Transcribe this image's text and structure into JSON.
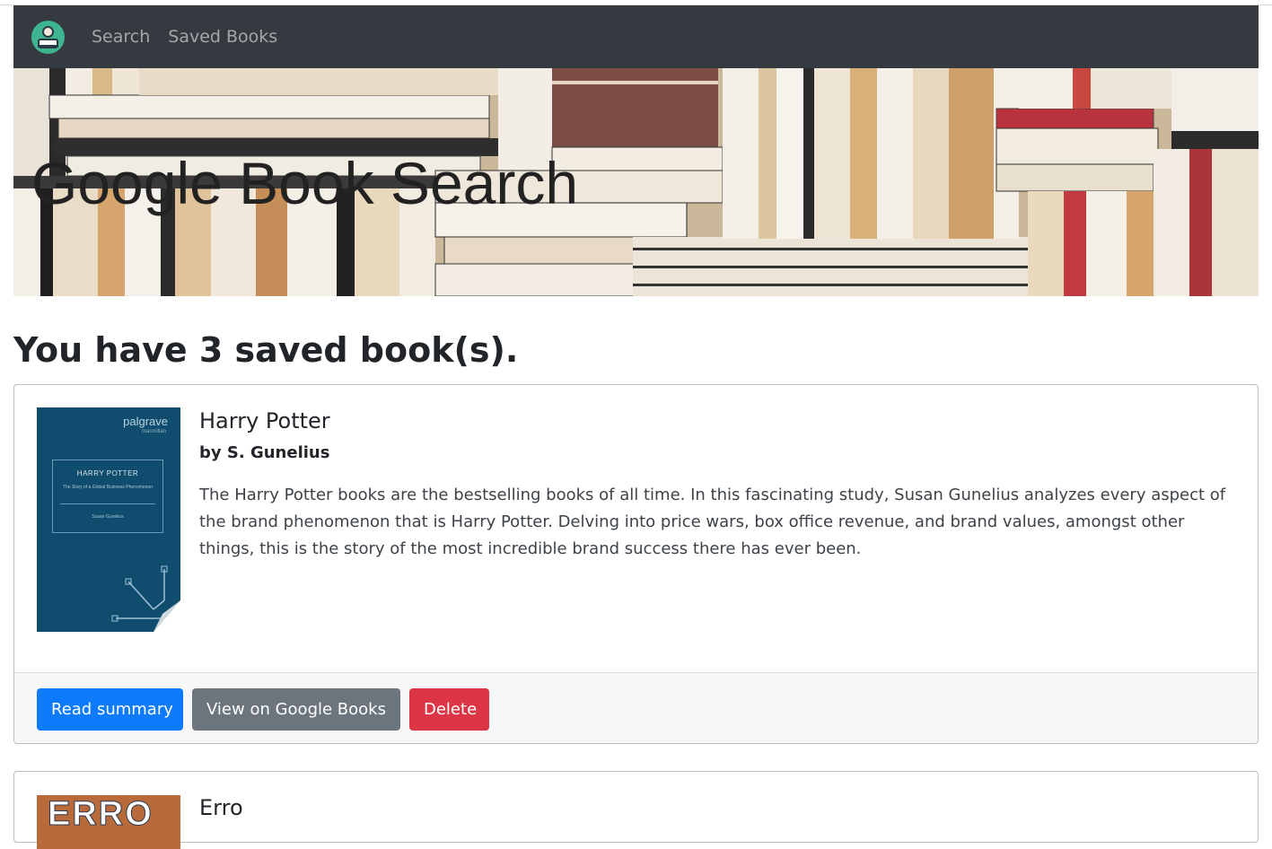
{
  "nav": {
    "logo_icon": "user-book-avatar-icon",
    "links": [
      "Search",
      "Saved Books"
    ]
  },
  "jumbotron": {
    "title": "Google Book Search",
    "background": "bookshelf-photo"
  },
  "saved_heading": "You have 3 saved book(s).",
  "books": [
    {
      "title": "Harry Potter",
      "author": "by S. Gunelius",
      "description": "The Harry Potter books are the bestselling books of all time. In this fascinating study, Susan Gunelius analyzes every aspect of the brand phenomenon that is Harry Potter. Delving into price wars, box office revenue, and brand values, amongst other things, this is the story of the most incredible brand success there has ever been.",
      "cover": {
        "publisher": "palgrave",
        "publisher_sub": "macmillan",
        "cover_title": "HARRY POTTER",
        "cover_subtitle": "The Story of a Global Business Phenomenon",
        "cover_author": "Susan Gunelius"
      },
      "buttons": {
        "read_summary": "Read summary",
        "view_google": "View on Google Books",
        "delete": "Delete"
      }
    },
    {
      "title": "Erro",
      "cover": {
        "cover_word": "ERRO"
      }
    }
  ],
  "colors": {
    "navbar": "#343a40",
    "primary": "#0d7bfb",
    "secondary": "#6c757d",
    "danger": "#dc3545"
  }
}
